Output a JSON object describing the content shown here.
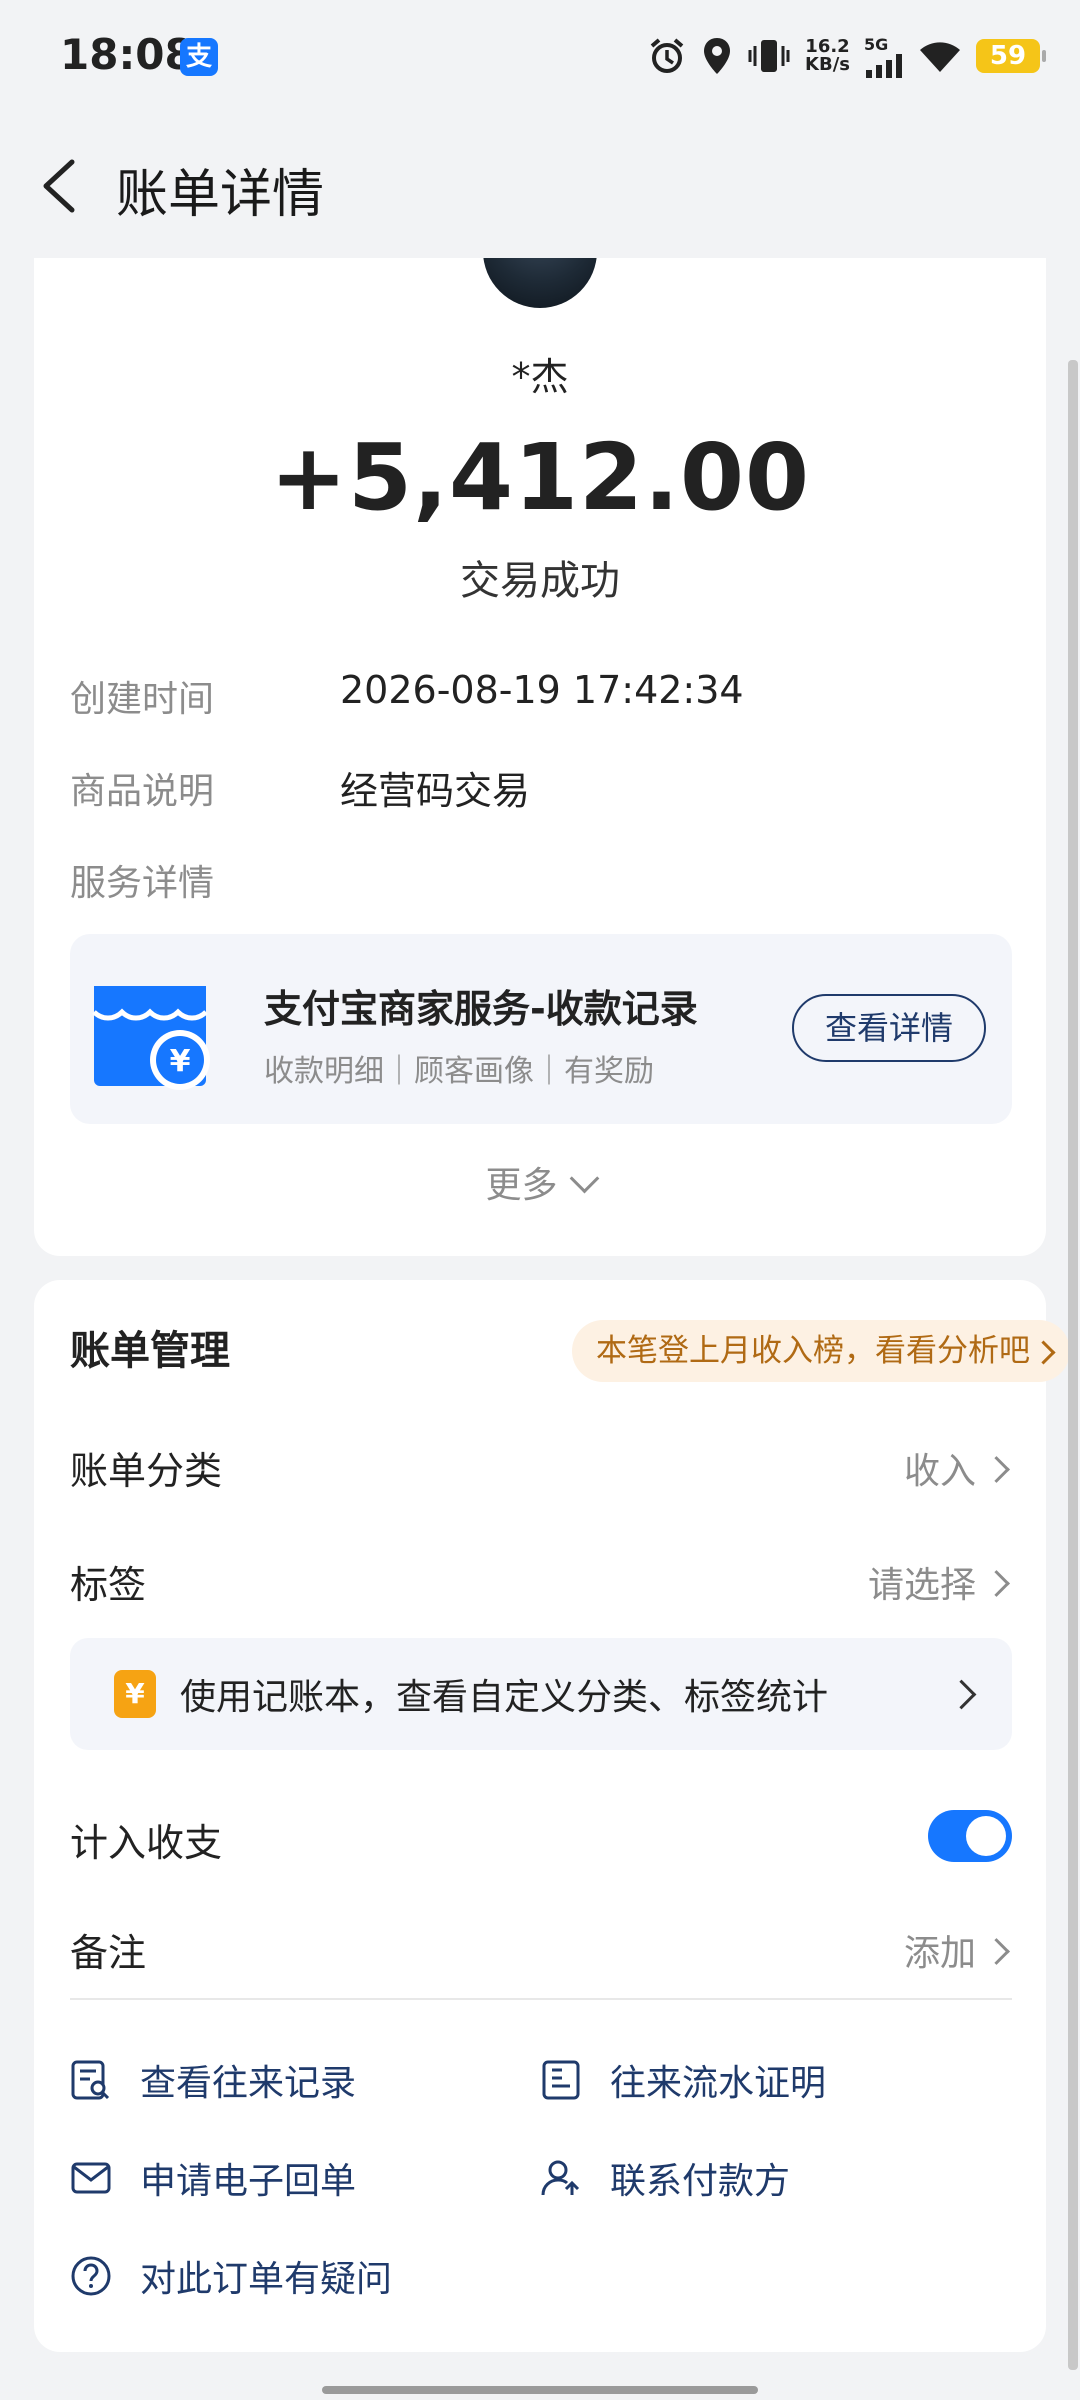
{
  "status_bar": {
    "time": "18:08",
    "alipay_badge": "支",
    "net_speed_value": "16.2",
    "net_speed_unit": "KB/s",
    "network_type": "5G",
    "battery": "59"
  },
  "nav": {
    "title": "账单详情"
  },
  "transaction": {
    "payer_name": "*杰",
    "amount": "+5,412.00",
    "status": "交易成功"
  },
  "details": [
    {
      "label": "创建时间",
      "value": "2026-08-19 17:42:34"
    },
    {
      "label": "商品说明",
      "value": "经营码交易"
    }
  ],
  "service": {
    "section_label": "服务详情",
    "title": "支付宝商家服务-收款记录",
    "subtitle": "收款明细｜顾客画像｜有奖励",
    "button": "查看详情",
    "icon": "shop-yuan-icon"
  },
  "more_label": "更多",
  "management": {
    "title": "账单管理",
    "badge": "本笔登上月收入榜，看看分析吧",
    "category_label": "账单分类",
    "category_value": "收入",
    "tag_label": "标签",
    "tag_value": "请选择",
    "book_icon_text": "¥",
    "book_text": "使用记账本，查看自定义分类、标签统计",
    "include_label": "计入收支",
    "include_enabled": true,
    "note_label": "备注",
    "note_value": "添加"
  },
  "actions": [
    {
      "label": "查看往来记录",
      "icon": "record-search-icon"
    },
    {
      "label": "往来流水证明",
      "icon": "statement-icon"
    },
    {
      "label": "申请电子回单",
      "icon": "mail-icon"
    },
    {
      "label": "联系付款方",
      "icon": "contact-user-icon"
    },
    {
      "label": "对此订单有疑问",
      "icon": "question-icon"
    }
  ],
  "colors": {
    "accent_blue": "#1677ff",
    "link_navy": "#1f3a6b",
    "badge_orange": "#b06a14",
    "background": "#f2f3f5"
  }
}
